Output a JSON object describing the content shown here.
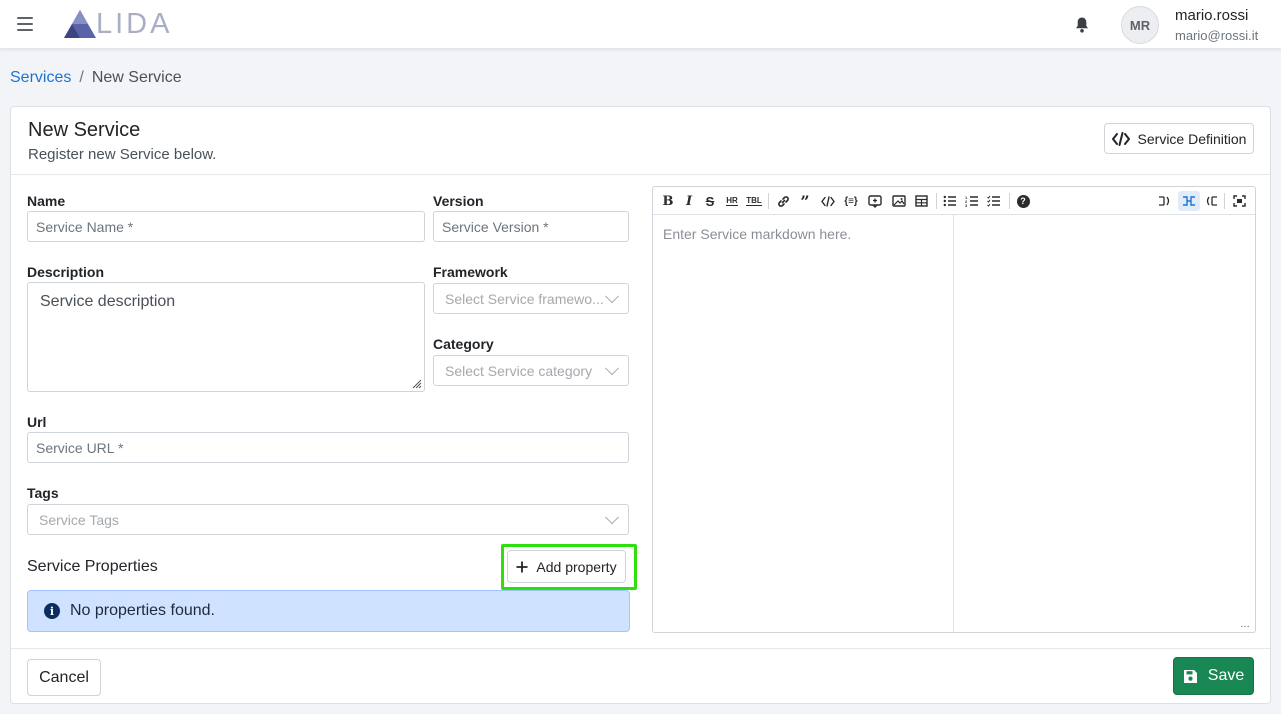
{
  "header": {
    "logo_text": "LIDA",
    "avatar_initials": "MR",
    "user_name": "mario.rossi",
    "user_email": "mario@rossi.it"
  },
  "breadcrumb": {
    "parent": "Services",
    "separator": "/",
    "current": "New Service"
  },
  "card": {
    "title": "New Service",
    "subtitle": "Register new Service below.",
    "definition_button": "Service Definition"
  },
  "form": {
    "name_label": "Name",
    "name_placeholder": "Service Name *",
    "version_label": "Version",
    "version_placeholder": "Service Version *",
    "description_label": "Description",
    "description_placeholder": "Service description",
    "framework_label": "Framework",
    "framework_placeholder": "Select Service framewo...",
    "category_label": "Category",
    "category_placeholder": "Select Service category",
    "url_label": "Url",
    "url_placeholder": "Service URL *",
    "tags_label": "Tags",
    "tags_placeholder": "Service Tags"
  },
  "properties": {
    "title": "Service Properties",
    "add_button": "Add property",
    "empty_message": "No properties found."
  },
  "editor": {
    "placeholder": "Enter Service markdown here.",
    "toolbar": [
      "bold-icon",
      "italic-icon",
      "strikethrough-icon",
      "hr-icon",
      "table-icon",
      "link-icon",
      "quote-icon",
      "code-icon",
      "codeblock-icon",
      "comment-icon",
      "image-icon",
      "grid-icon",
      "bullet-list-icon",
      "ordered-list-icon",
      "task-list-icon",
      "help-icon",
      "edit-mode-icon",
      "split-mode-icon",
      "preview-mode-icon",
      "fullscreen-icon"
    ]
  },
  "footer": {
    "cancel": "Cancel",
    "save": "Save"
  },
  "colors": {
    "accent": "#1d74d0",
    "save": "#198754",
    "highlight": "#2ee00b",
    "alert_bg": "#cfe2ff"
  }
}
